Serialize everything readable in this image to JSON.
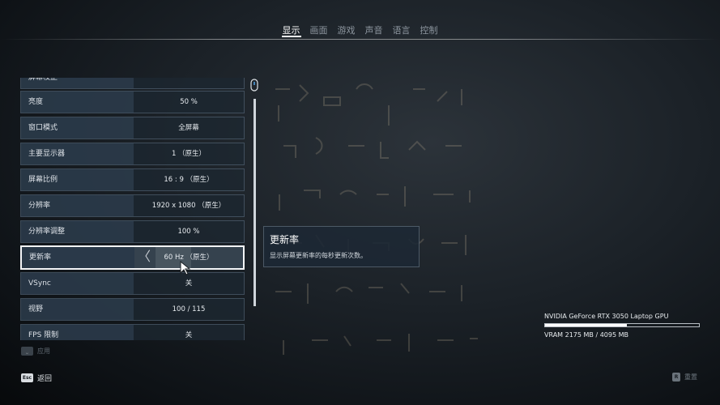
{
  "tabs": [
    {
      "label": "显示",
      "active": true
    },
    {
      "label": "画面",
      "active": false
    },
    {
      "label": "游戏",
      "active": false
    },
    {
      "label": "声音",
      "active": false
    },
    {
      "label": "语言",
      "active": false
    },
    {
      "label": "控制",
      "active": false
    }
  ],
  "settings": [
    {
      "label": "屏幕校正",
      "value": ""
    },
    {
      "label": "亮度",
      "value": "50 %"
    },
    {
      "label": "窗口模式",
      "value": "全屏幕"
    },
    {
      "label": "主要显示器",
      "value": "1 （原生）"
    },
    {
      "label": "屏幕比例",
      "value": "16 : 9 （原生）"
    },
    {
      "label": "分辨率",
      "value": "1920 x 1080 （原生）"
    },
    {
      "label": "分辨率调整",
      "value": "100 %"
    },
    {
      "label": "更新率",
      "value": "60 Hz （原生）",
      "selected": true
    },
    {
      "label": "VSync",
      "value": "关"
    },
    {
      "label": "视野",
      "value": "100 / 115"
    },
    {
      "label": "FPS 限制",
      "value": "关"
    }
  ],
  "info_panel": {
    "title": "更新率",
    "description": "显示屏幕更新率的每秒更新次数。"
  },
  "hints": {
    "apply_label": "应用",
    "back_key": "Esc",
    "back_label": "返回",
    "reset_key": "R",
    "reset_label": "重置"
  },
  "gpu": {
    "name": "NVIDIA GeForce RTX 3050 Laptop GPU",
    "vram_text": "VRAM 2175 MB / 4095 MB",
    "vram_used_fraction": 0.531
  },
  "colors": {
    "accent": "#ffffff",
    "row_label_bg": "#2c3c4c",
    "panel_bg": "#1c2834"
  },
  "icons": {
    "scroll": "mouse-scroll-icon",
    "cursor": "mouse-cursor-icon",
    "left_arrow": "chevron-left-icon"
  }
}
